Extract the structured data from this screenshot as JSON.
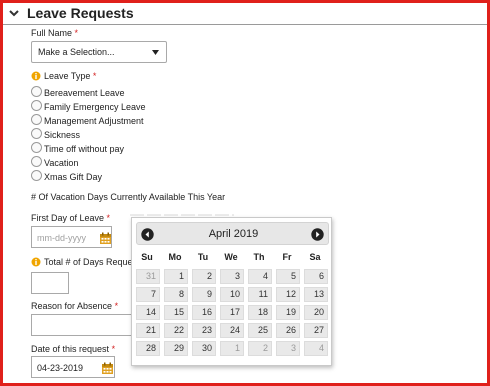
{
  "section": {
    "title": "Leave Requests"
  },
  "full_name": {
    "label": "Full Name",
    "required": "*",
    "selected": "Make a Selection..."
  },
  "leave_type": {
    "label": "Leave Type",
    "required": "*",
    "options": [
      "Bereavement Leave",
      "Family Emergency Leave",
      "Management Adjustment",
      "Sickness",
      "Time off without pay",
      "Vacation",
      "Xmas Gift Day"
    ]
  },
  "vacation_days": {
    "label": "# Of Vacation Days Currently Available This Year"
  },
  "first_day": {
    "label": "First Day of Leave",
    "required": "*",
    "placeholder": "mm-dd-yyyy"
  },
  "total_days": {
    "label": "Total # of Days Reque",
    "required": ""
  },
  "reason": {
    "label": "Reason for Absence",
    "required": "*"
  },
  "request_date": {
    "label": "Date of this request",
    "required": "*",
    "value": "04-23-2019"
  },
  "calendar": {
    "month": "April 2019",
    "weekdays": [
      "Su",
      "Mo",
      "Tu",
      "We",
      "Th",
      "Fr",
      "Sa"
    ],
    "weeks": [
      [
        "31",
        "1",
        "2",
        "3",
        "4",
        "5",
        "6"
      ],
      [
        "7",
        "8",
        "9",
        "10",
        "11",
        "12",
        "13"
      ],
      [
        "14",
        "15",
        "16",
        "17",
        "18",
        "19",
        "20"
      ],
      [
        "21",
        "22",
        "23",
        "24",
        "25",
        "26",
        "27"
      ],
      [
        "28",
        "29",
        "30",
        "1",
        "2",
        "3",
        "4"
      ]
    ],
    "other_month": [
      [
        0,
        0
      ],
      [
        4,
        3
      ],
      [
        4,
        4
      ],
      [
        4,
        5
      ],
      [
        4,
        6
      ]
    ]
  },
  "icons": {
    "collapse": "chevron-down-icon",
    "info": "info-icon",
    "calendar": "calendar-icon",
    "prev": "prev-month-icon",
    "next": "next-month-icon"
  },
  "colors": {
    "frame": "#e0201b",
    "required": "#d21f1f",
    "info": "#f0a500",
    "calendar_icon": "#e0a020"
  }
}
